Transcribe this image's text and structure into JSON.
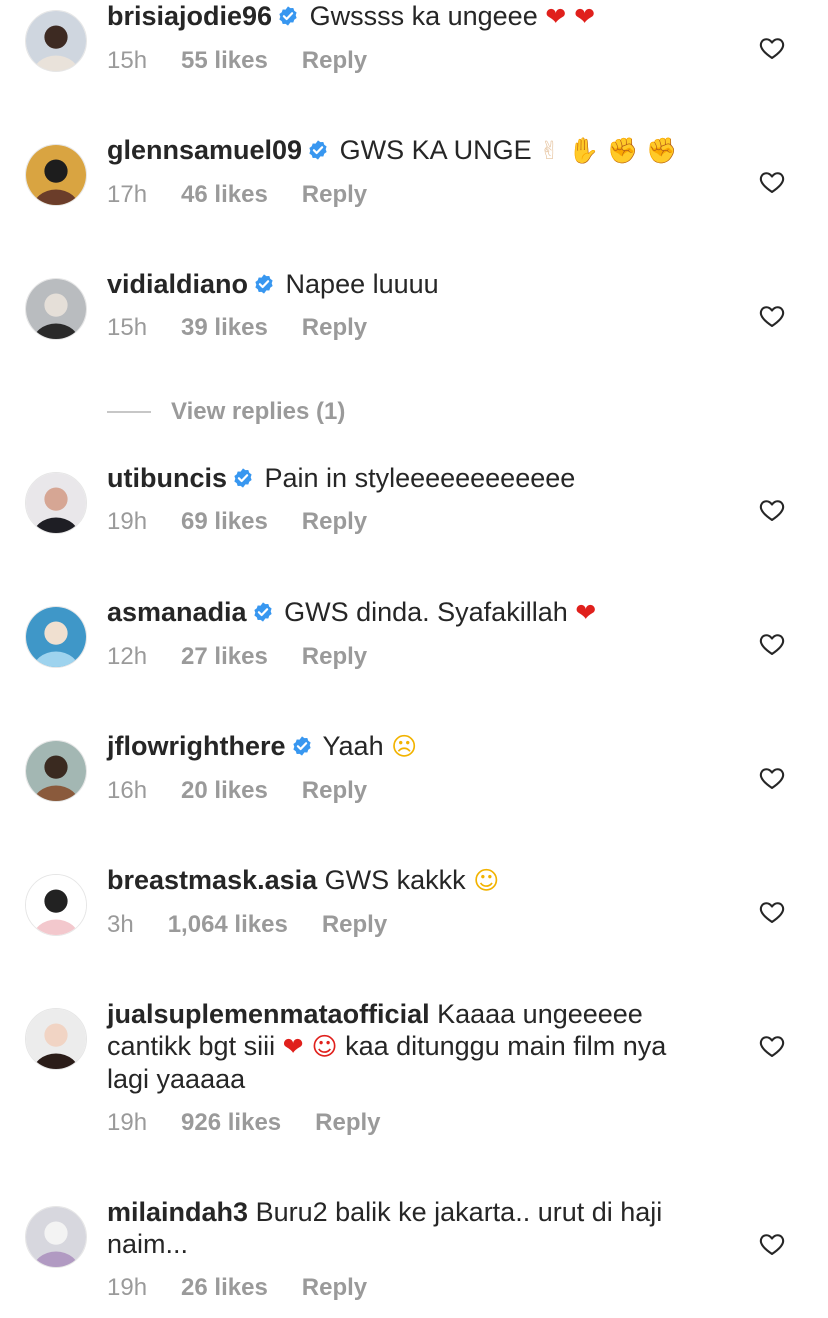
{
  "comments": [
    {
      "username": "brisiajodie96",
      "verified": true,
      "text": "Gwssss ka ungeee",
      "emoji": "❤ ❤",
      "emoji_type": "heart",
      "time": "15h",
      "likes": "55 likes",
      "reply": "Reply",
      "avatar_colors": [
        "#cfd6df",
        "#e9e2da",
        "#3d2a22"
      ]
    },
    {
      "username": "glennsamuel09",
      "verified": true,
      "text": "GWS KA UNGE",
      "emoji": "✌ ✋ ✊ ✊",
      "emoji_type": "hand",
      "time": "17h",
      "likes": "46 likes",
      "reply": "Reply",
      "avatar_colors": [
        "#d9a441",
        "#6b3d2a",
        "#1d1d1d"
      ]
    },
    {
      "username": "vidialdiano",
      "verified": true,
      "text": "Napee luuuu",
      "emoji": "",
      "emoji_type": "",
      "time": "15h",
      "likes": "39 likes",
      "reply": "Reply",
      "avatar_colors": [
        "#b9bcbf",
        "#2a2a2a",
        "#e5dfd8"
      ]
    },
    {
      "username": "utibuncis",
      "verified": true,
      "text": "Pain in styleeeeeeeeeeee",
      "emoji": "",
      "emoji_type": "",
      "time": "19h",
      "likes": "69 likes",
      "reply": "Reply",
      "avatar_colors": [
        "#e9e7ea",
        "#1e1e24",
        "#d6a694"
      ]
    },
    {
      "username": "asmanadia",
      "verified": true,
      "text": "GWS dinda. Syafakillah",
      "emoji": "❤",
      "emoji_type": "heart",
      "time": "12h",
      "likes": "27 likes",
      "reply": "Reply",
      "avatar_colors": [
        "#3f97c8",
        "#9ed3ee",
        "#f0e0d0"
      ]
    },
    {
      "username": "jflowrighthere",
      "verified": true,
      "text": "Yaah",
      "emoji": "☹",
      "emoji_type": "face",
      "time": "16h",
      "likes": "20 likes",
      "reply": "Reply",
      "avatar_colors": [
        "#a3b7b3",
        "#8a5a3c",
        "#3a2a20"
      ]
    },
    {
      "username": "breastmask.asia",
      "verified": false,
      "text": "GWS kakkk",
      "emoji": "☺",
      "emoji_type": "face",
      "time": "3h",
      "likes": "1,064 likes",
      "reply": "Reply",
      "avatar_colors": [
        "#ffffff",
        "#f3c8cd",
        "#222222"
      ]
    },
    {
      "username": "jualsuplemenmataofficial",
      "verified": false,
      "text": "Kaaaa ungeeeee cantikk bgt siii",
      "emoji": "❤ ☺",
      "emoji_type": "heart",
      "text2": "kaa ditunggu main film nya lagi yaaaaa",
      "time": "19h",
      "likes": "926 likes",
      "reply": "Reply",
      "avatar_colors": [
        "#ececec",
        "#2a1c18",
        "#f1d4c4"
      ]
    },
    {
      "username": "milaindah3",
      "verified": false,
      "text": "Buru2 balik ke jakarta.. urut di haji naim...",
      "emoji": "",
      "emoji_type": "",
      "time": "19h",
      "likes": "26 likes",
      "reply": "Reply",
      "avatar_colors": [
        "#d7d7de",
        "#b19ac2",
        "#f3f3f3"
      ]
    }
  ],
  "view_replies": "View replies (1)",
  "colors": {
    "text": "#262626",
    "meta": "#9a9a9a",
    "verified": "#3897f0",
    "divider": "#c7c7c7"
  }
}
